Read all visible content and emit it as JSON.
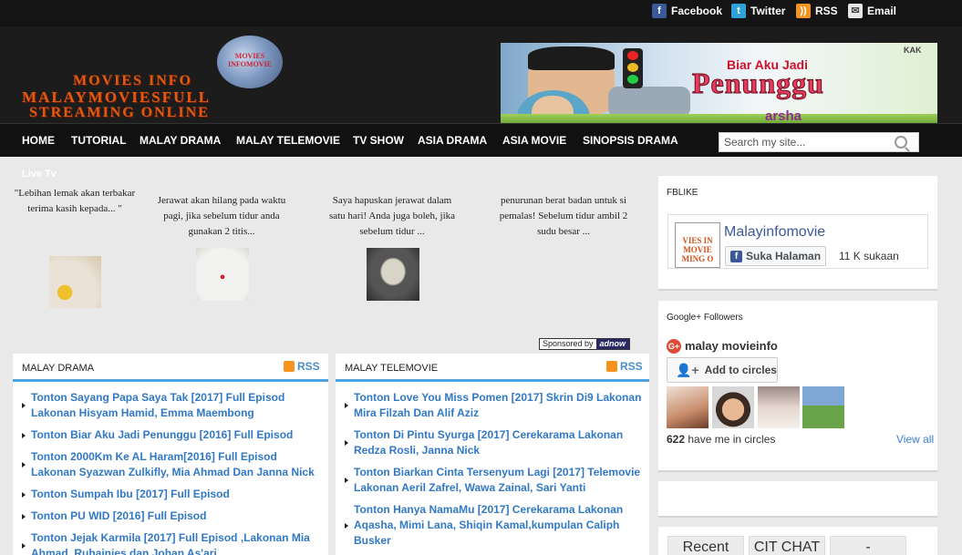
{
  "topbar": {
    "links": [
      {
        "label": "Facebook",
        "icon": "facebook-icon",
        "color": "#3b5998"
      },
      {
        "label": "Twitter",
        "icon": "twitter-icon",
        "color": "#2fa0d9"
      },
      {
        "label": "RSS",
        "icon": "rss-icon",
        "color": "#f6921e"
      },
      {
        "label": "Email",
        "icon": "email-icon",
        "color": "#e6e6e6"
      }
    ]
  },
  "header": {
    "logo_globe_text": "MOVIES INFOMOVIE",
    "logo_lines": [
      "MOVIES INFO",
      "MALAYMOVIESFULL",
      "STREAMING ONLINE"
    ],
    "logo_color": "#e05a12",
    "banner": {
      "corner_text": "KAK",
      "line1": "Biar Aku Jadi",
      "line2": "Penunggu",
      "line3": "arsha"
    }
  },
  "nav": {
    "items": [
      "HOME",
      "TUTORIAL",
      "MALAY DRAMA",
      "MALAY TELEMOVIE",
      "TV SHOW",
      "ASIA DRAMA",
      "ASIA MOVIE",
      "SINOPSIS DRAMA"
    ],
    "search_placeholder": "Search my site..."
  },
  "livetv": {
    "label": "Live Tv"
  },
  "ads": [
    {
      "text": "\"Lebihan lemak akan terbakar terima kasih kepada... \""
    },
    {
      "text": "Jerawat akan hilang pada waktu pagi, jika sebelum tidur anda gunakan 2 titis..."
    },
    {
      "text": "Saya hapuskan jerawat dalam satu hari! Anda juga boleh, jika sebelum tidur ..."
    },
    {
      "text": "penurunan berat badan untuk si pemalas! Sebelum tidur ambil 2 sudu besar ..."
    }
  ],
  "sponsored": {
    "label": "Sponsored by",
    "brand": "adnow"
  },
  "malay_drama": {
    "title": "MALAY DRAMA",
    "rss": "RSS",
    "posts": [
      "Tonton Sayang Papa Saya Tak [2017] Full Episod Lakonan Hisyam Hamid, Emma Maembong",
      "Tonton Biar Aku Jadi Penunggu [2016] Full Episod",
      "Tonton 2000Km Ke AL Haram[2016] Full Episod Lakonan Syazwan Zulkifly, Mia Ahmad Dan Janna Nick",
      "Tonton Sumpah Ibu [2017] Full Episod",
      "Tonton PU WID [2016] Full Episod",
      "Tonton Jejak Karmila [2017] Full Episod ,Lakonan Mia Ahmad, Ruhainies dan Johan As'ari"
    ]
  },
  "malay_telemovie": {
    "title": "MALAY TELEMOVIE",
    "rss": "RSS",
    "posts": [
      "Tonton Love You Miss Pomen [2017] Skrin Di9 Lakonan Mira Filzah Dan Alif Aziz",
      "Tonton Di Pintu Syurga [2017] Cerekarama Lakonan Redza Rosli, Janna Nick",
      "Tonton Biarkan Cinta Tersenyum Lagi [2017] Telemovie Lakonan Aeril Zafrel, Wawa Zainal, Sari Yanti",
      "Tonton Hanya NamaMu [2017] Cerekarama Lakonan Aqasha, Mimi Lana, Shiqin Kamal,kumpulan Caliph Busker"
    ]
  },
  "fblike": {
    "title": "FBLIKE",
    "logo_text": "VIES IN MOVIE MING O",
    "page_name": "Malayinfomovie",
    "like_label": "Suka Halaman",
    "count": "11 K sukaan"
  },
  "gplus": {
    "title": "Google+ Followers",
    "name": "malay movieinfo",
    "add_label": "Add to circles",
    "count_num": "622",
    "count_text": " have me in circles",
    "view_all": "View all"
  },
  "chat_tabs": {
    "tabs": [
      "Recent",
      "CIT CHAT",
      "-"
    ]
  }
}
